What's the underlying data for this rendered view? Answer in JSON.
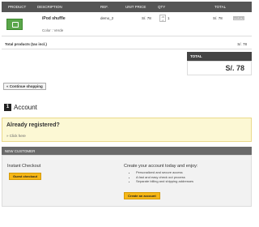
{
  "cart": {
    "columns": [
      "Product",
      "Description",
      "Ref.",
      "Unit price",
      "Qty",
      "Total"
    ],
    "item": {
      "name": "iPod shuffle",
      "color": "Color : Verde",
      "ref": "demo_2",
      "unit_price": "S/. 78",
      "qty_control": "-30\n+1",
      "quantity": "1",
      "total": "S/. 78",
      "delete_label": "DELETE"
    },
    "total_products_label": "Total products (tax incl.)",
    "total_products_value": "S/. 78",
    "total_label": "TOTAL",
    "total_value": "S/. 78"
  },
  "continue_label": "« Continue shopping",
  "account": {
    "step": "1",
    "title": "Account",
    "registered_title": "Already registered?",
    "click_here": "» Click here"
  },
  "new_customer": {
    "header": "New Customer",
    "instant_title": "Instant Checkout",
    "guest_button": "Guest checkout",
    "create_title": "Create your account today and enjoy:",
    "benefits": [
      "Personalized and secure access",
      "A fast and easy check out process",
      "Separate billing and shipping addresses"
    ],
    "create_button": "Create an account"
  },
  "colors": {
    "header_bg": "#555555",
    "accent_button": "#f6b717",
    "registered_bg": "#fcf8d4",
    "thumbnail": "#5aa64a"
  },
  "icons": {
    "product_thumbnail": "ipod-shuffle-thumbnail-icon"
  }
}
